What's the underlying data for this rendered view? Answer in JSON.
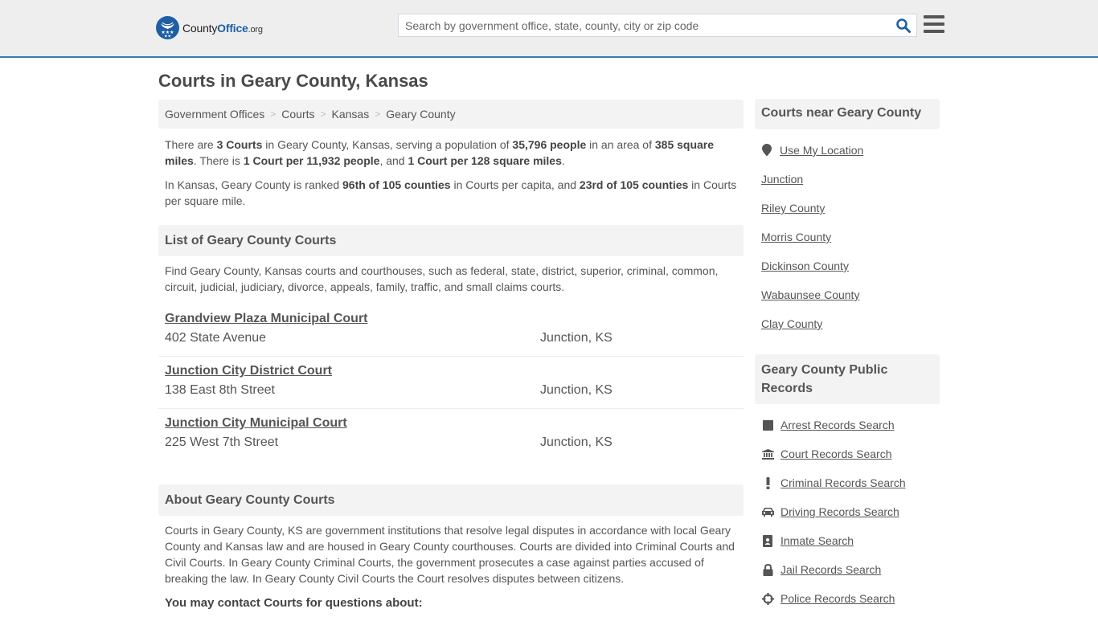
{
  "header": {
    "logo": {
      "prefix": "County",
      "brand": "Office",
      "tld": ".org"
    },
    "search": {
      "placeholder": "Search by government office, state, county, city or zip code",
      "value": ""
    },
    "search_icon": "search-icon",
    "menu_icon": "hamburger-menu-icon",
    "accent_color": "#1e5fa3",
    "border_color": "#3a7bb0"
  },
  "page": {
    "title": "Courts in Geary County, Kansas"
  },
  "breadcrumb": [
    {
      "label": "Government Offices"
    },
    {
      "label": "Courts"
    },
    {
      "label": "Kansas"
    },
    {
      "label": "Geary County"
    }
  ],
  "intro": {
    "p1": {
      "t1": "There are ",
      "b1": "3 Courts",
      "t2": " in Geary County, Kansas, serving a population of ",
      "b2": "35,796 people",
      "t3": " in an area of ",
      "b3": "385 square miles",
      "t4": ". There is ",
      "b4": "1 Court per 11,932 people",
      "t5": ", and ",
      "b5": "1 Court per 128 square miles",
      "t6": "."
    },
    "p2": {
      "t1": "In Kansas, Geary County is ranked ",
      "b1": "96th of 105 counties",
      "t2": " in Courts per capita, and ",
      "b2": "23rd of 105 counties",
      "t3": " in Courts per square mile."
    }
  },
  "list_section": {
    "heading": "List of Geary County Courts",
    "description": "Find Geary County, Kansas courts and courthouses, such as federal, state, district, superior, criminal, common, circuit, judicial, judiciary, divorce, appeals, family, traffic, and small claims courts.",
    "courts": [
      {
        "name": "Grandview Plaza Municipal Court",
        "address": "402 State Avenue",
        "city": "Junction, KS"
      },
      {
        "name": "Junction City District Court",
        "address": "138 East 8th Street",
        "city": "Junction, KS"
      },
      {
        "name": "Junction City Municipal Court",
        "address": "225 West 7th Street",
        "city": "Junction, KS"
      }
    ]
  },
  "about_section": {
    "heading": "About Geary County Courts",
    "text": "Courts in Geary County, KS are government institutions that resolve legal disputes in accordance with local Geary County and Kansas law and are housed in Geary County courthouses. Courts are divided into Criminal Courts and Civil Courts. In Geary County Criminal Courts, the government prosecutes a case against parties accused of breaking the law. In Geary County Civil Courts the Court resolves disputes between citizens.",
    "contact_heading": "You may contact Courts for questions about:"
  },
  "sidebar": {
    "nearby": {
      "heading": "Courts near Geary County",
      "use_location": {
        "label": "Use My Location",
        "icon": "map-marker-icon"
      },
      "items": [
        {
          "label": "Junction"
        },
        {
          "label": "Riley County"
        },
        {
          "label": "Morris County"
        },
        {
          "label": "Dickinson County"
        },
        {
          "label": "Wabaunsee County"
        },
        {
          "label": "Clay County"
        }
      ]
    },
    "records": {
      "heading": "Geary County Public Records",
      "items": [
        {
          "label": "Arrest Records Search",
          "icon": "square-icon"
        },
        {
          "label": "Court Records Search",
          "icon": "courthouse-icon"
        },
        {
          "label": "Criminal Records Search",
          "icon": "exclamation-icon"
        },
        {
          "label": "Driving Records Search",
          "icon": "car-icon"
        },
        {
          "label": "Inmate Search",
          "icon": "id-badge-icon"
        },
        {
          "label": "Jail Records Search",
          "icon": "lock-icon"
        },
        {
          "label": "Police Records Search",
          "icon": "crosshairs-icon"
        }
      ]
    }
  }
}
